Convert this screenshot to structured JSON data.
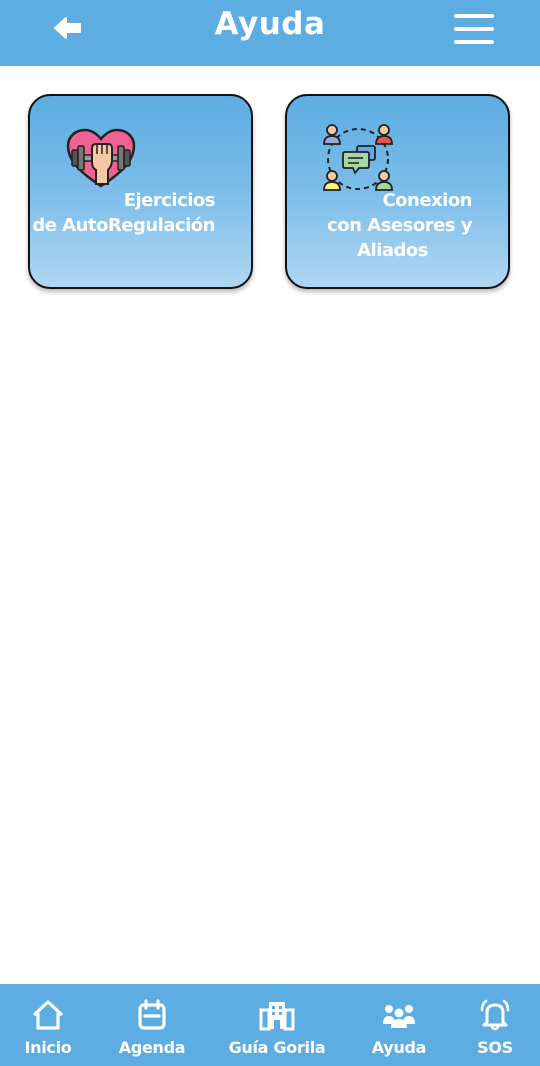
{
  "header": {
    "title": "Ayuda",
    "back_icon": "arrow-left-icon",
    "menu_icon": "hamburger-menu-icon",
    "background_color": "#5DADE2"
  },
  "cards": [
    {
      "line1": "Ejercicios",
      "line2": "de AutoRegulación",
      "icon": "heart-dumbbell-icon"
    },
    {
      "line1": "Conexion",
      "line2": "con Asesores y",
      "line3": "Aliados",
      "icon": "people-chat-network-icon"
    }
  ],
  "nav": [
    {
      "label": "Inicio",
      "icon": "home-icon"
    },
    {
      "label": "Agenda",
      "icon": "calendar-icon"
    },
    {
      "label": "Guía Gorila",
      "icon": "building-icon"
    },
    {
      "label": "Ayuda",
      "icon": "group-icon"
    },
    {
      "label": "SOS",
      "icon": "bell-alert-icon"
    }
  ],
  "colors": {
    "accent": "#5DADE2",
    "card_gradient_end": "#AFD6F3",
    "text_on_accent": "#FFFFFF"
  }
}
